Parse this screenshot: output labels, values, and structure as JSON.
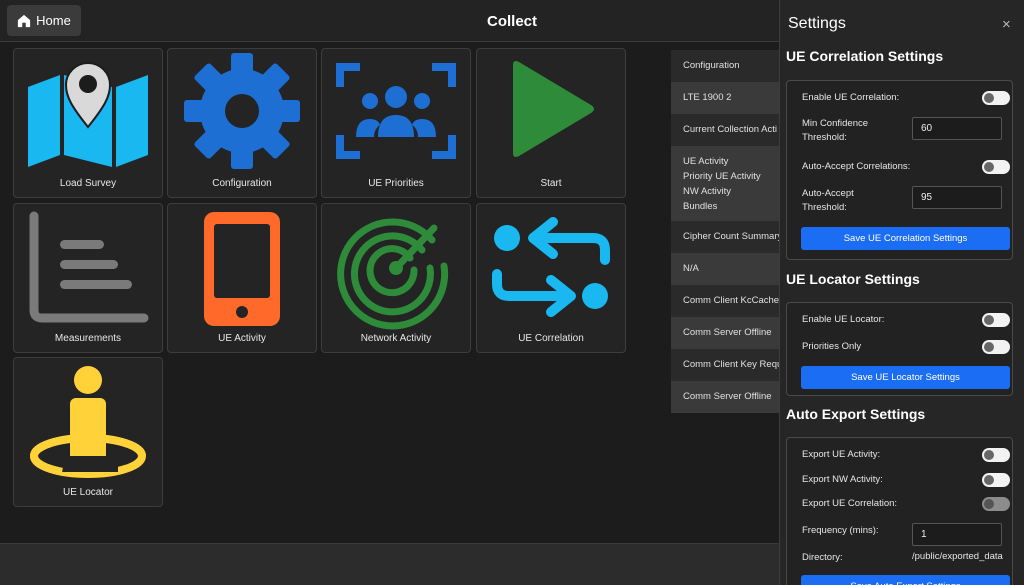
{
  "header": {
    "home_label": "Home",
    "title": "Collect"
  },
  "tiles": [
    {
      "label": "Load Survey",
      "icon": "map-pin-icon"
    },
    {
      "label": "Configuration",
      "icon": "gear-icon"
    },
    {
      "label": "UE Priorities",
      "icon": "group-focus-icon"
    },
    {
      "label": "Start",
      "icon": "play-icon"
    },
    {
      "label": "Measurements",
      "icon": "list-chart-icon"
    },
    {
      "label": "UE Activity",
      "icon": "phone-icon"
    },
    {
      "label": "Network Activity",
      "icon": "radar-icon"
    },
    {
      "label": "UE Correlation",
      "icon": "swap-arrows-icon"
    },
    {
      "label": "UE Locator",
      "icon": "person-location-icon"
    }
  ],
  "status_table": {
    "configuration_header": "Configuration",
    "configuration_value": "LTE 1900 2",
    "collection_header": "Current Collection Acti",
    "collection_items": [
      "UE Activity",
      "Priority UE Activity",
      "NW Activity",
      "Bundles"
    ],
    "cipher_header": "Cipher Count Summary",
    "cipher_value": "N/A",
    "kccache_header": "Comm Client KcCache S",
    "kccache_value": "Comm Server Offline",
    "keyreq_header": "Comm Client Key Requ",
    "keyreq_value": "Comm Server Offline"
  },
  "settings": {
    "title": "Settings",
    "close_glyph": "×",
    "ue_correlation": {
      "title": "UE Correlation Settings",
      "enable_label": "Enable UE Correlation:",
      "min_conf_label_1": "Min Confidence",
      "min_conf_label_2": "Threshold:",
      "min_conf_value": "60",
      "auto_accept_label": "Auto-Accept Correlations:",
      "auto_thresh_label_1": "Auto-Accept",
      "auto_thresh_label_2": "Threshold:",
      "auto_thresh_value": "95",
      "save_label": "Save UE Correlation Settings"
    },
    "ue_locator": {
      "title": "UE Locator Settings",
      "enable_label": "Enable UE Locator:",
      "priorities_label": "Priorities Only",
      "save_label": "Save UE Locator Settings"
    },
    "auto_export": {
      "title": "Auto Export Settings",
      "ue_activity_label": "Export UE Activity:",
      "nw_activity_label": "Export NW Activity:",
      "ue_correlation_label": "Export UE Correlation:",
      "frequency_label": "Frequency (mins):",
      "frequency_value": "1",
      "directory_label": "Directory:",
      "directory_value": "/public/exported_data",
      "save_label": "Save Auto Export Settings"
    }
  },
  "colors": {
    "cyan": "#1ab8f0",
    "blue": "#1d6fd4",
    "green": "#2e8b3a",
    "orange": "#ff6a2a",
    "gray": "#7a7a7a",
    "yellow": "#ffd23a",
    "button_blue": "#1b6ef3"
  }
}
